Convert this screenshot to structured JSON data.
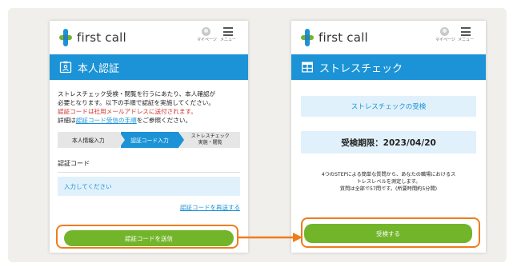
{
  "app": {
    "logo_text": "first call",
    "mypage_label": "マイページ",
    "menu_label": "メニュー"
  },
  "left_screen": {
    "title": "本人認証",
    "intro_line1": "ストレスチェック受検・閲覧を行うにあたり、本人確認が",
    "intro_line2": "必要となります。以下の手順で認証を実施してください。",
    "intro_red": "認証コードは社用メールアドレスに送付されます。",
    "intro_prefix": "詳細は",
    "intro_link": "認証コード受信の手順",
    "intro_suffix": "をご参照ください。",
    "steps": [
      "本人情報入力",
      "認証コード入力",
      "ストレスチェック",
      "実施・閲覧"
    ],
    "code_label": "認証コード",
    "code_placeholder": "入力してください",
    "resend_link": "認証コードを再送する",
    "submit_button": "認証コードを送信"
  },
  "right_screen": {
    "title": "ストレスチェック",
    "section_title": "ストレスチェックの受検",
    "deadline": "受検期限：2023/04/20",
    "desc_line1": "4つのSTEPによる簡単な質問から、あなたの職場におけるス",
    "desc_line2": "トレスレベルを測定します。",
    "desc_line3": "質問は全部で57問です。(所要時間約5分間)",
    "start_button": "受検する"
  },
  "colors": {
    "brand_blue": "#1b93d6",
    "brand_green": "#72b52a",
    "highlight_orange": "#ef7d1a",
    "input_bg": "#e1f1fb",
    "warning_red": "#d0312d"
  },
  "icons": [
    "first-call-logo-icon",
    "avatar-icon",
    "hamburger-menu-icon",
    "id-card-icon",
    "table-icon",
    "right-arrow-icon"
  ]
}
